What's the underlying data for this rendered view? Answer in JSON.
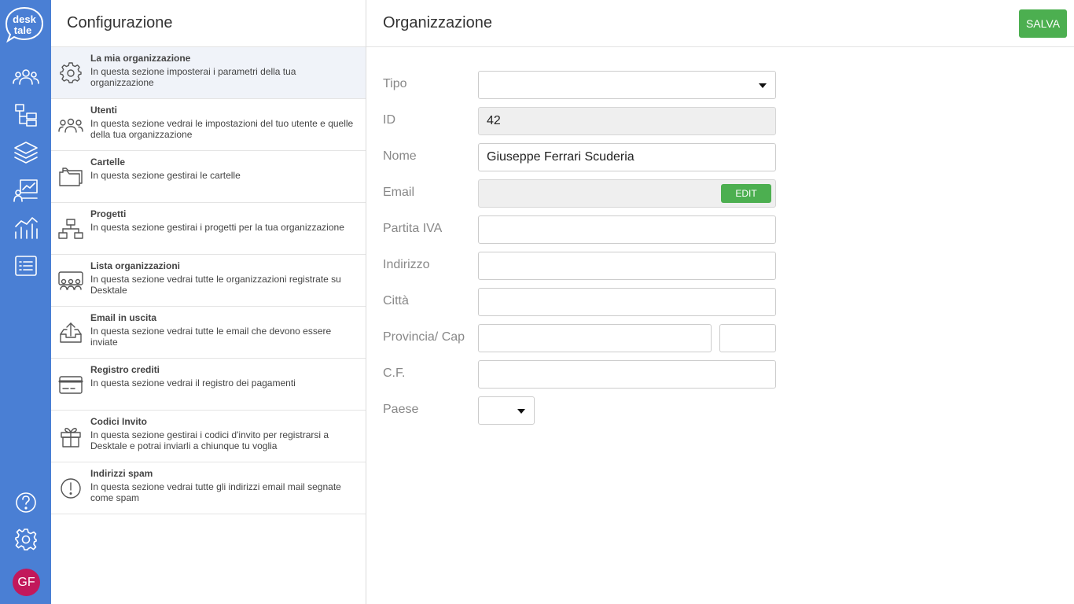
{
  "brand": {
    "logo_line1": "desk",
    "logo_line2": "tale"
  },
  "rail": {
    "icons": [
      "users-icon",
      "folder-tree-icon",
      "layers-icon",
      "chart-board-icon",
      "bar-chart-icon",
      "list-icon"
    ],
    "bottom_icons": [
      "help-icon",
      "settings-icon"
    ],
    "avatar_initials": "GF",
    "avatar_color": "#c2185b"
  },
  "settings": {
    "title": "Configurazione",
    "items": [
      {
        "title": "La mia organizzazione",
        "desc": "In questa sezione imposterai i parametri della tua organizzazione",
        "icon": "gear-icon",
        "active": true
      },
      {
        "title": "Utenti",
        "desc": "In questa sezione vedrai le impostazioni del tuo utente e quelle della tua organizzazione",
        "icon": "users-icon"
      },
      {
        "title": "Cartelle",
        "desc": "In questa sezione gestirai le cartelle",
        "icon": "folder-icon"
      },
      {
        "title": "Progetti",
        "desc": "In questa sezione gestirai i progetti per la tua organizzazione",
        "icon": "sitemap-icon"
      },
      {
        "title": "Lista organizzazioni",
        "desc": "In questa sezione vedrai tutte le organizzazioni registrate su Desktale",
        "icon": "organizations-icon"
      },
      {
        "title": "Email in uscita",
        "desc": "In questa sezione vedrai tutte le email che devono essere inviate",
        "icon": "outbox-icon"
      },
      {
        "title": "Registro crediti",
        "desc": "In questa sezione vedrai il registro dei pagamenti",
        "icon": "credit-card-icon"
      },
      {
        "title": "Codici Invito",
        "desc": "In questa sezione gestirai i codici d'invito per registrarsi a Desktale e potrai inviarli a chiunque tu voglia",
        "icon": "gift-icon"
      },
      {
        "title": "Indirizzi spam",
        "desc": "In questa sezione vedrai tutte gli indirizzi email mail segnate come spam",
        "icon": "warning-icon"
      }
    ]
  },
  "main": {
    "title": "Organizzazione",
    "save_label": "SALVA",
    "form": {
      "tipo": {
        "label": "Tipo",
        "value": ""
      },
      "id": {
        "label": "ID",
        "value": "42"
      },
      "nome": {
        "label": "Nome",
        "value": "Giuseppe Ferrari Scuderia"
      },
      "email": {
        "label": "Email",
        "value": "",
        "edit_label": "EDIT"
      },
      "partita_iva": {
        "label": "Partita IVA",
        "value": ""
      },
      "indirizzo": {
        "label": "Indirizzo",
        "value": ""
      },
      "citta": {
        "label": "Città",
        "value": ""
      },
      "provincia_cap": {
        "label": "Provincia/ Cap",
        "provincia": "",
        "cap": ""
      },
      "cf": {
        "label": "C.F.",
        "value": ""
      },
      "paese": {
        "label": "Paese",
        "value": ""
      }
    }
  },
  "colors": {
    "rail": "#4a7fd4",
    "accent_green": "#4caf50",
    "active_item": "#f0f3f9"
  }
}
